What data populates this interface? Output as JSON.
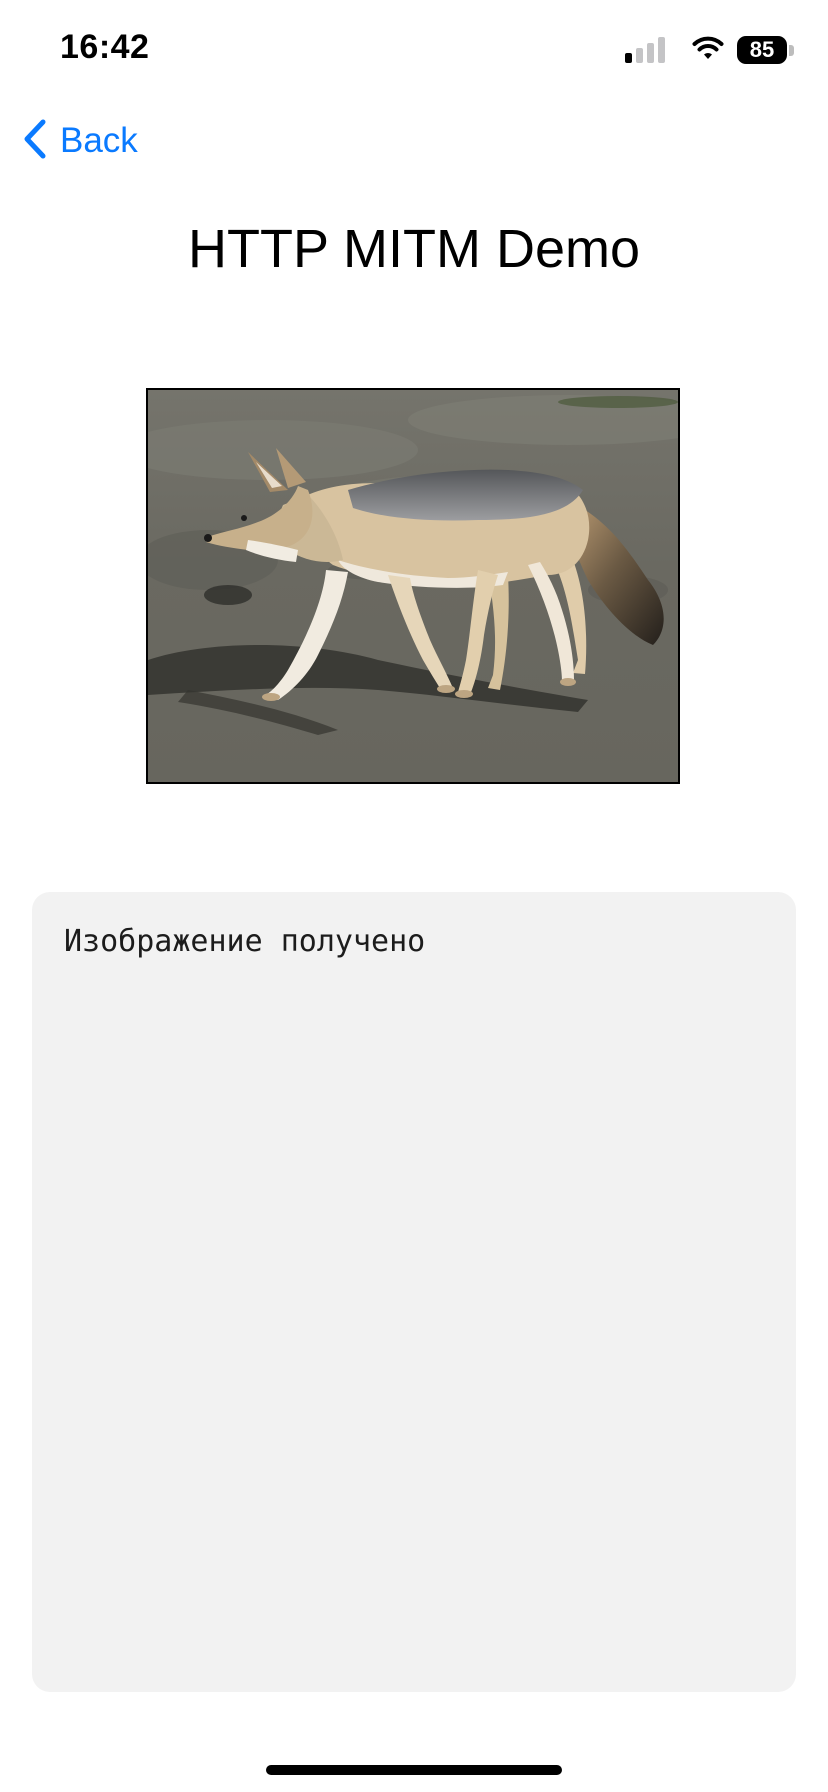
{
  "status_bar": {
    "time": "16:42",
    "battery_level": "85",
    "signal_bars_active": 1,
    "signal_bars_total": 4,
    "icons": [
      "cellular-signal-icon",
      "wifi-icon",
      "battery-icon"
    ]
  },
  "nav": {
    "back_label": "Back",
    "back_icon": "chevron-left-icon"
  },
  "page": {
    "title": "HTTP MITM Demo"
  },
  "image": {
    "subject": "jackal-photo"
  },
  "log": {
    "text": "Изображение получено"
  },
  "colors": {
    "accent": "#0a7aff",
    "panel_background": "#f2f2f2",
    "text": "#000000"
  }
}
